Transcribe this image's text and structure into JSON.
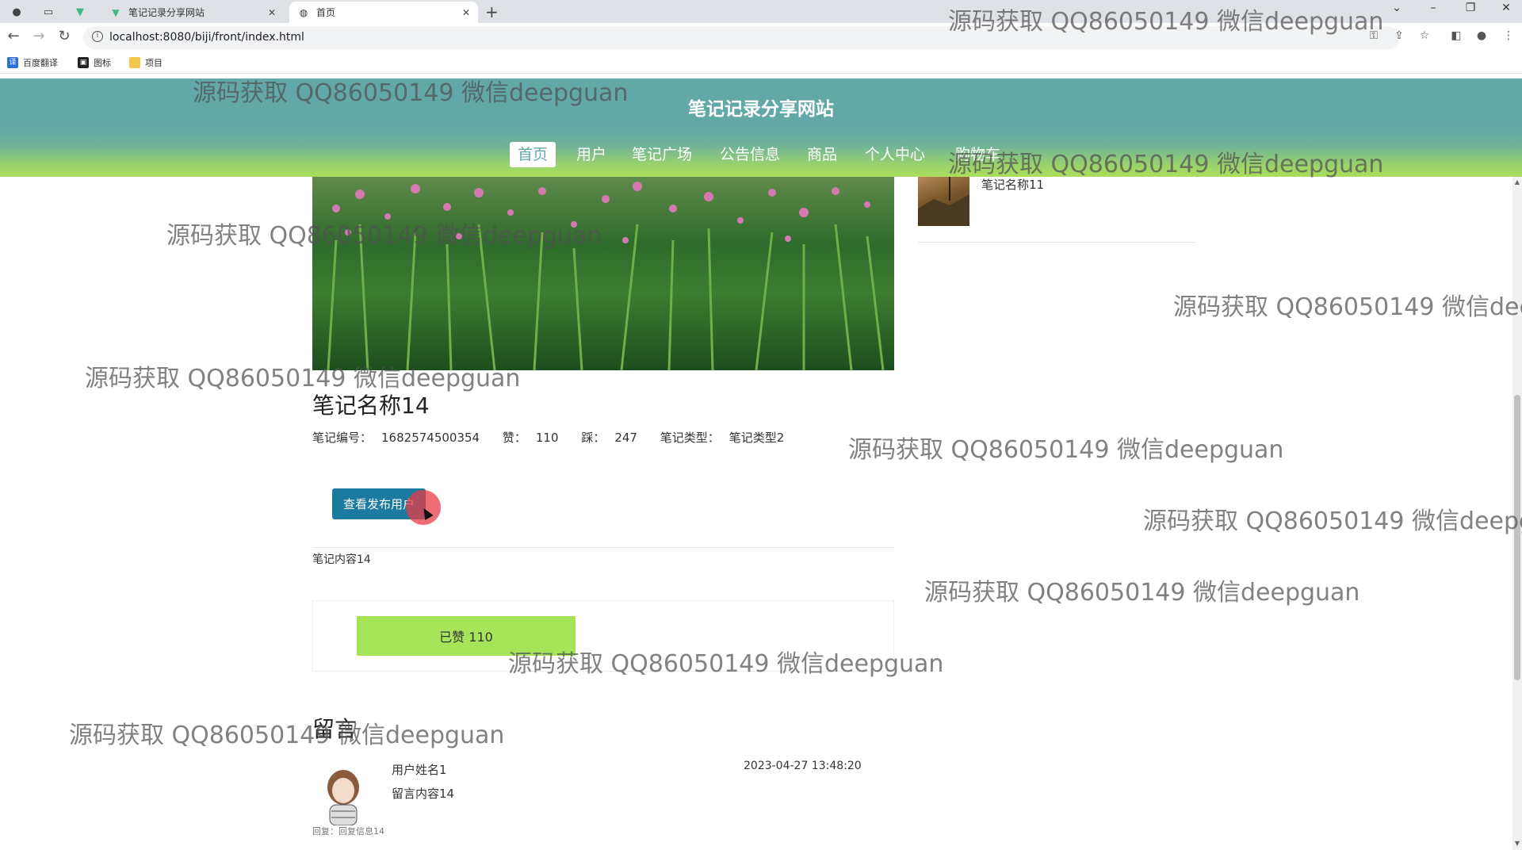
{
  "browser": {
    "tabs": [
      {
        "title": "笔记记录分享网站",
        "icon": "vue-logo-icon",
        "active": false
      },
      {
        "title": "首页",
        "icon": "globe-icon",
        "active": true
      }
    ],
    "url": "localhost:8080/biji/front/index.html",
    "bookmarks": [
      {
        "label": "百度翻译",
        "icon": "translate-icon"
      },
      {
        "label": "图标",
        "icon": "image-icon"
      },
      {
        "label": "项目",
        "icon": "folder-icon"
      }
    ]
  },
  "site": {
    "title": "笔记记录分享网站",
    "menu": [
      "首页",
      "用户",
      "笔记广场",
      "公告信息",
      "商品",
      "个人中心",
      "购物车"
    ],
    "active_menu": "首页"
  },
  "note": {
    "title": "笔记名称14",
    "meta": {
      "id_label": "笔记编号：",
      "id_value": "1682574500354",
      "likes_label": "赞：",
      "likes_value": "110",
      "dislikes_label": "踩：",
      "dislikes_value": "247",
      "type_label": "笔记类型：",
      "type_value": "笔记类型2"
    },
    "view_user_button": "查看发布用户",
    "content": "笔记内容14",
    "liked_button": "已赞   110"
  },
  "comments": {
    "title": "留言",
    "items": [
      {
        "user": "用户姓名1",
        "text": "留言内容14",
        "time": "2023-04-27 13:48:20",
        "reply": "回复：回复信息14"
      }
    ]
  },
  "sidebar": {
    "items": [
      {
        "name": "笔记名称11"
      }
    ]
  },
  "watermark": "源码获取 QQ86050149 微信deepguan",
  "colors": {
    "header": "#62a8a7",
    "header_bottom": "#a9df5c",
    "button": "#1a7aa0",
    "like": "#a6e45a"
  }
}
